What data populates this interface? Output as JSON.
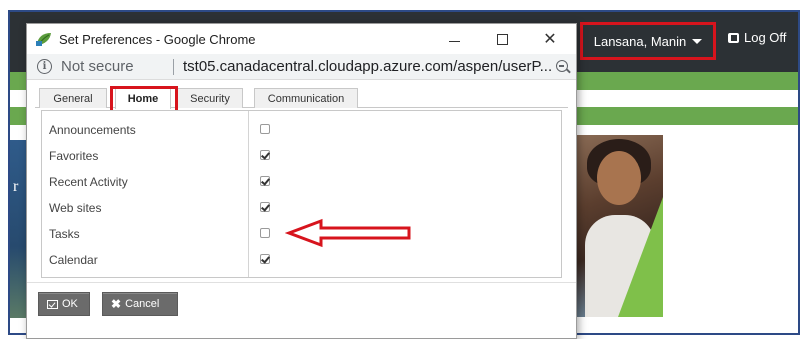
{
  "background_page": {
    "user_menu_label": "Lansana, Manin",
    "logoff_label": "Log Off"
  },
  "window": {
    "title": "Set Preferences - Google Chrome",
    "security_label": "Not secure",
    "url": "tst05.canadacentral.cloudapp.azure.com/aspen/userP..."
  },
  "tabs": [
    {
      "label": "General"
    },
    {
      "label": "Home",
      "selected": true
    },
    {
      "label": "Security"
    },
    {
      "label": "Communication"
    }
  ],
  "preferences": [
    {
      "label": "Announcements",
      "checked": false
    },
    {
      "label": "Favorites",
      "checked": true
    },
    {
      "label": "Recent Activity",
      "checked": true
    },
    {
      "label": "Web sites",
      "checked": true
    },
    {
      "label": "Tasks",
      "checked": false
    },
    {
      "label": "Calendar",
      "checked": true
    }
  ],
  "buttons": {
    "ok_label": "OK",
    "cancel_label": "Cancel"
  },
  "colors": {
    "highlight_red": "#d7141d",
    "header_dark": "#2c3135",
    "accent_green": "#6aa84f",
    "button_gray": "#6b6b6b"
  }
}
